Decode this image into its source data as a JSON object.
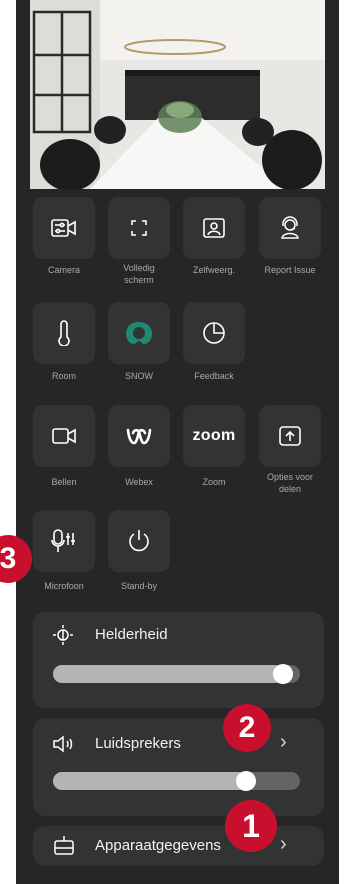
{
  "tiles": {
    "camera": "Camera",
    "fullscreen_line1": "Volledig",
    "fullscreen_line2": "scherm",
    "selfview": "Zelfweerg.",
    "report_issue": "Report Issue",
    "room": "Room",
    "snow": "SNOW",
    "feedback": "Feedback",
    "call": "Bellen",
    "webex": "Webex",
    "zoom": "Zoom",
    "zoom_logo_text": "zoom",
    "share_line1": "Opties voor",
    "share_line2": "delen",
    "microphone": "Microfoon",
    "standby": "Stand-by"
  },
  "brightness": {
    "label": "Helderheid",
    "level_percent": 93
  },
  "speakers": {
    "label": "Luidsprekers",
    "volume_percent": 78
  },
  "device": {
    "label": "Apparaatgegevens"
  },
  "annotations": {
    "badge1": "1",
    "badge2": "2",
    "badge3": "3"
  },
  "colors": {
    "panel_bg": "#262626",
    "tile_bg": "#333333",
    "badge_red": "#c8102e",
    "snow_green": "#1f8a72"
  }
}
